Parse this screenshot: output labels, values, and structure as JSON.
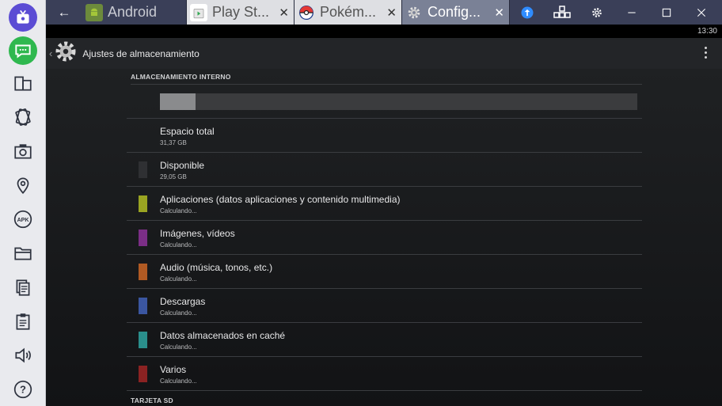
{
  "sidebar": {
    "items": [
      {
        "name": "tv-icon"
      },
      {
        "name": "chat-icon"
      },
      {
        "name": "rotate-screen-icon"
      },
      {
        "name": "shake-icon"
      },
      {
        "name": "camera-icon"
      },
      {
        "name": "location-icon"
      },
      {
        "name": "apk-icon",
        "label": "APK"
      },
      {
        "name": "folder-icon"
      },
      {
        "name": "copy-icon"
      },
      {
        "name": "paste-icon"
      },
      {
        "name": "volume-icon"
      },
      {
        "name": "help-icon",
        "label": "?"
      }
    ],
    "accent_purple": "#5b4cd4",
    "accent_green": "#2fb84f"
  },
  "topbar": {
    "back_label": "←",
    "tabs": [
      {
        "label": "Android",
        "icon": "android-icon"
      },
      {
        "label": "Play St...",
        "icon": "play-store-icon"
      },
      {
        "label": "Pokém...",
        "icon": "pokeball-icon"
      },
      {
        "label": "Config...",
        "icon": "settings-gear-icon"
      }
    ],
    "close_label": "✕",
    "window_buttons": [
      "upload-icon",
      "keyboard-icon",
      "gear-icon",
      "minimize-icon",
      "maximize-icon",
      "close-icon"
    ]
  },
  "statusbar": {
    "time": "13:30"
  },
  "actionbar": {
    "title": "Ajustes de almacenamiento",
    "icon": "settings-gear-icon"
  },
  "storage": {
    "internal_header": "ALMACENAMIENTO INTERNO",
    "used_fraction": 0.074,
    "rows": [
      {
        "title": "Espacio total",
        "value": "31,37 GB",
        "color": ""
      },
      {
        "title": "Disponible",
        "value": "29,05 GB",
        "color": "#2f3033"
      },
      {
        "title": "Aplicaciones (datos aplicaciones y contenido multimedia)",
        "value": "Calculando...",
        "color": "#9aa422"
      },
      {
        "title": "Imágenes, vídeos",
        "value": "Calculando...",
        "color": "#7b2e86"
      },
      {
        "title": "Audio (música, tonos, etc.)",
        "value": "Calculando...",
        "color": "#b15a23"
      },
      {
        "title": "Descargas",
        "value": "Calculando...",
        "color": "#3b56a0"
      },
      {
        "title": "Datos almacenados en caché",
        "value": "Calculando...",
        "color": "#2a8e8b"
      },
      {
        "title": "Varios",
        "value": "Calculando...",
        "color": "#8b2222"
      }
    ],
    "sd_header": "TARJETA SD"
  }
}
